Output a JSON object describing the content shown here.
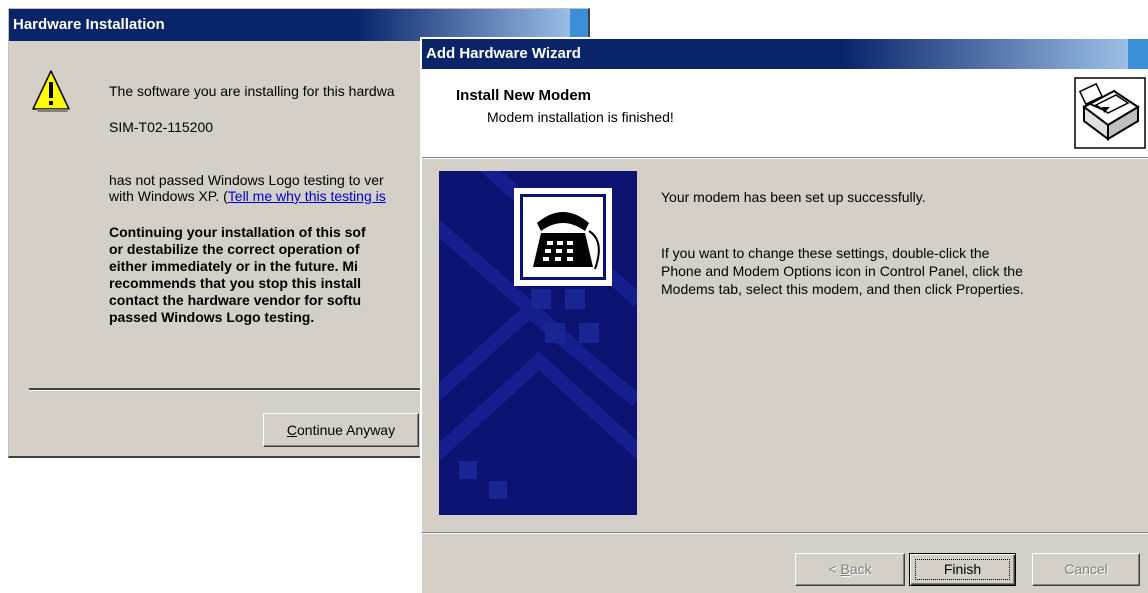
{
  "hardware_installation": {
    "title": "Hardware Installation",
    "message_line1": "The software you are installing for this hardwa",
    "device_name": "SIM-T02-115200",
    "message_line2": "has not passed Windows Logo testing to ver",
    "message_line3_prefix": "with Windows XP. (",
    "link_text": "Tell me why this testing is",
    "bold_lines": [
      "Continuing your installation of this sof",
      "or destabilize the correct operation of",
      "either immediately or in the future. Mi",
      "recommends that you stop this install",
      "contact the hardware vendor for softu",
      "passed Windows Logo testing."
    ],
    "continue_button": {
      "mnemonic": "C",
      "rest": "ontinue Anyway"
    }
  },
  "add_hardware_wizard": {
    "title": "Add Hardware Wizard",
    "header_title": "Install New Modem",
    "header_subtitle": "Modem installation is finished!",
    "message_success": "Your modem has been set up successfully.",
    "message_lines": [
      "If you want to change these settings, double-click the",
      "Phone and Modem Options icon in Control Panel, click the",
      "Modems tab, select this modem, and then click Properties."
    ],
    "buttons": {
      "back": {
        "prefix": "< ",
        "mnemonic": "B",
        "rest": "ack",
        "enabled": false
      },
      "finish": {
        "label": "Finish",
        "enabled": true
      },
      "cancel": {
        "label": "Cancel",
        "enabled": false
      }
    }
  },
  "colors": {
    "titlebar_active": "#0a246a",
    "dialog_face": "#d4d0c8",
    "link": "#0000cc",
    "disabled_text": "#808080",
    "wizard_art": "#0c1272"
  },
  "icons": [
    "warning-icon",
    "hardware-icon",
    "telephone-icon"
  ]
}
